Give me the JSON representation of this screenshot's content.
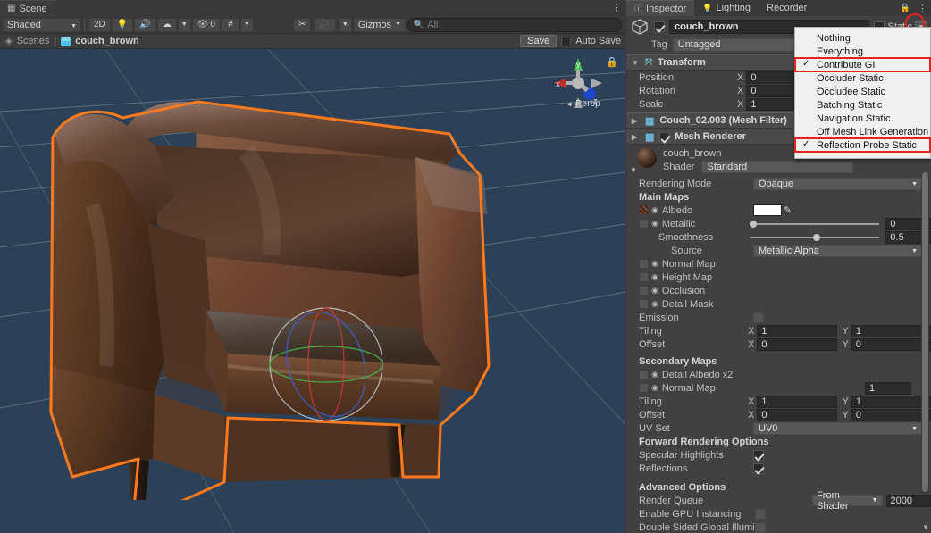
{
  "scene": {
    "tab_label": "Scene",
    "tab_icon": "grid-icon",
    "toolbar": {
      "draw_mode": "Shaded",
      "two_d": "2D",
      "lighting_icon": "lightbulb-icon",
      "audio_icon": "speaker-icon",
      "fx_icon": "effects-icon",
      "hidden_objects_count": "0",
      "grid_icon": "grid-visibility-icon",
      "tools_icon": "tools-icon",
      "camera_icon": "camera-icon",
      "gizmos_label": "Gizmos",
      "search_placeholder": "All",
      "search_value": ""
    },
    "breadcrumb": {
      "root": "Scenes",
      "separator": "|",
      "object": "couch_brown",
      "save_label": "Save",
      "auto_save_label": "Auto Save",
      "auto_save_checked": false
    },
    "viewport": {
      "persp_label": "Persp",
      "axis_x": "x",
      "axis_y": "y",
      "axis_z": "z",
      "background_color": "#2c4057",
      "selection_outline_color": "#ff7a1e",
      "model_name": "couch_brown"
    }
  },
  "inspector": {
    "tabs": [
      {
        "label": "Inspector",
        "icon": "info-icon",
        "active": true
      },
      {
        "label": "Lighting",
        "icon": "lightbulb-icon",
        "active": false
      },
      {
        "label": "Recorder",
        "icon": "",
        "active": false
      }
    ],
    "lock_icon": "lock-icon",
    "menu_icon": "kebab-menu-icon",
    "object": {
      "enabled": true,
      "name": "couch_brown",
      "static_label": "Static",
      "static_mixed": true,
      "tag_label": "Tag",
      "tag_value": "Untagged"
    },
    "transform": {
      "title": "Transform",
      "rows": [
        {
          "label": "Position",
          "axis": "X",
          "value": "0"
        },
        {
          "label": "Rotation",
          "axis": "X",
          "value": "0"
        },
        {
          "label": "Scale",
          "axis": "X",
          "value": "1"
        }
      ]
    },
    "mesh_filter": {
      "title": "Couch_02.003 (Mesh Filter)"
    },
    "mesh_renderer": {
      "title": "Mesh Renderer",
      "enabled": true
    },
    "material": {
      "name": "couch_brown",
      "shader_label": "Shader",
      "shader_value": "Standard",
      "rendering_mode_label": "Rendering Mode",
      "rendering_mode_value": "Opaque",
      "main_maps_title": "Main Maps",
      "albedo_label": "Albedo",
      "albedo_color": "#ffffff",
      "metallic_label": "Metallic",
      "metallic_value": "0",
      "smoothness_label": "Smoothness",
      "smoothness_value": "0.5",
      "source_label": "Source",
      "source_value": "Metallic Alpha",
      "normal_map_label": "Normal Map",
      "height_map_label": "Height Map",
      "occlusion_label": "Occlusion",
      "detail_mask_label": "Detail Mask",
      "emission_label": "Emission",
      "emission_checked": false,
      "tiling_label": "Tiling",
      "tiling_x_axis": "X",
      "tiling_x": "1",
      "tiling_y_axis": "Y",
      "tiling_y": "1",
      "offset_label": "Offset",
      "offset_x_axis": "X",
      "offset_x": "0",
      "offset_y_axis": "Y",
      "offset_y": "0",
      "secondary_maps_title": "Secondary Maps",
      "detail_albedo_label": "Detail Albedo x2",
      "sec_normal_map_label": "Normal Map",
      "sec_normal_value": "1",
      "sec_tiling_label": "Tiling",
      "sec_tiling_x_axis": "X",
      "sec_tiling_x": "1",
      "sec_tiling_y_axis": "Y",
      "sec_tiling_y": "1",
      "sec_offset_label": "Offset",
      "sec_offset_x_axis": "X",
      "sec_offset_x": "0",
      "sec_offset_y_axis": "Y",
      "sec_offset_y": "0",
      "uv_set_label": "UV Set",
      "uv_set_value": "UV0",
      "forward_title": "Forward Rendering Options",
      "specular_label": "Specular Highlights",
      "specular_checked": true,
      "reflections_label": "Reflections",
      "reflections_checked": true,
      "advanced_title": "Advanced Options",
      "render_queue_label": "Render Queue",
      "render_queue_mode": "From Shader",
      "render_queue_value": "2000",
      "gpu_instancing_label": "Enable GPU Instancing",
      "gpu_instancing_checked": false,
      "double_sided_label": "Double Sided Global Illuminatio",
      "double_sided_checked": false
    }
  },
  "static_dropdown": {
    "items": [
      {
        "label": "Nothing",
        "checked": false,
        "highlighted": false
      },
      {
        "label": "Everything",
        "checked": false,
        "highlighted": false
      },
      {
        "label": "Contribute GI",
        "checked": true,
        "highlighted": true
      },
      {
        "label": "Occluder Static",
        "checked": false,
        "highlighted": false
      },
      {
        "label": "Occludee Static",
        "checked": false,
        "highlighted": false
      },
      {
        "label": "Batching Static",
        "checked": false,
        "highlighted": false
      },
      {
        "label": "Navigation Static",
        "checked": false,
        "highlighted": false
      },
      {
        "label": "Off Mesh Link Generation",
        "checked": false,
        "highlighted": false
      },
      {
        "label": "Reflection Probe Static",
        "checked": true,
        "highlighted": true
      }
    ],
    "check_glyph": "✓",
    "highlight_color": "#e8231e"
  }
}
